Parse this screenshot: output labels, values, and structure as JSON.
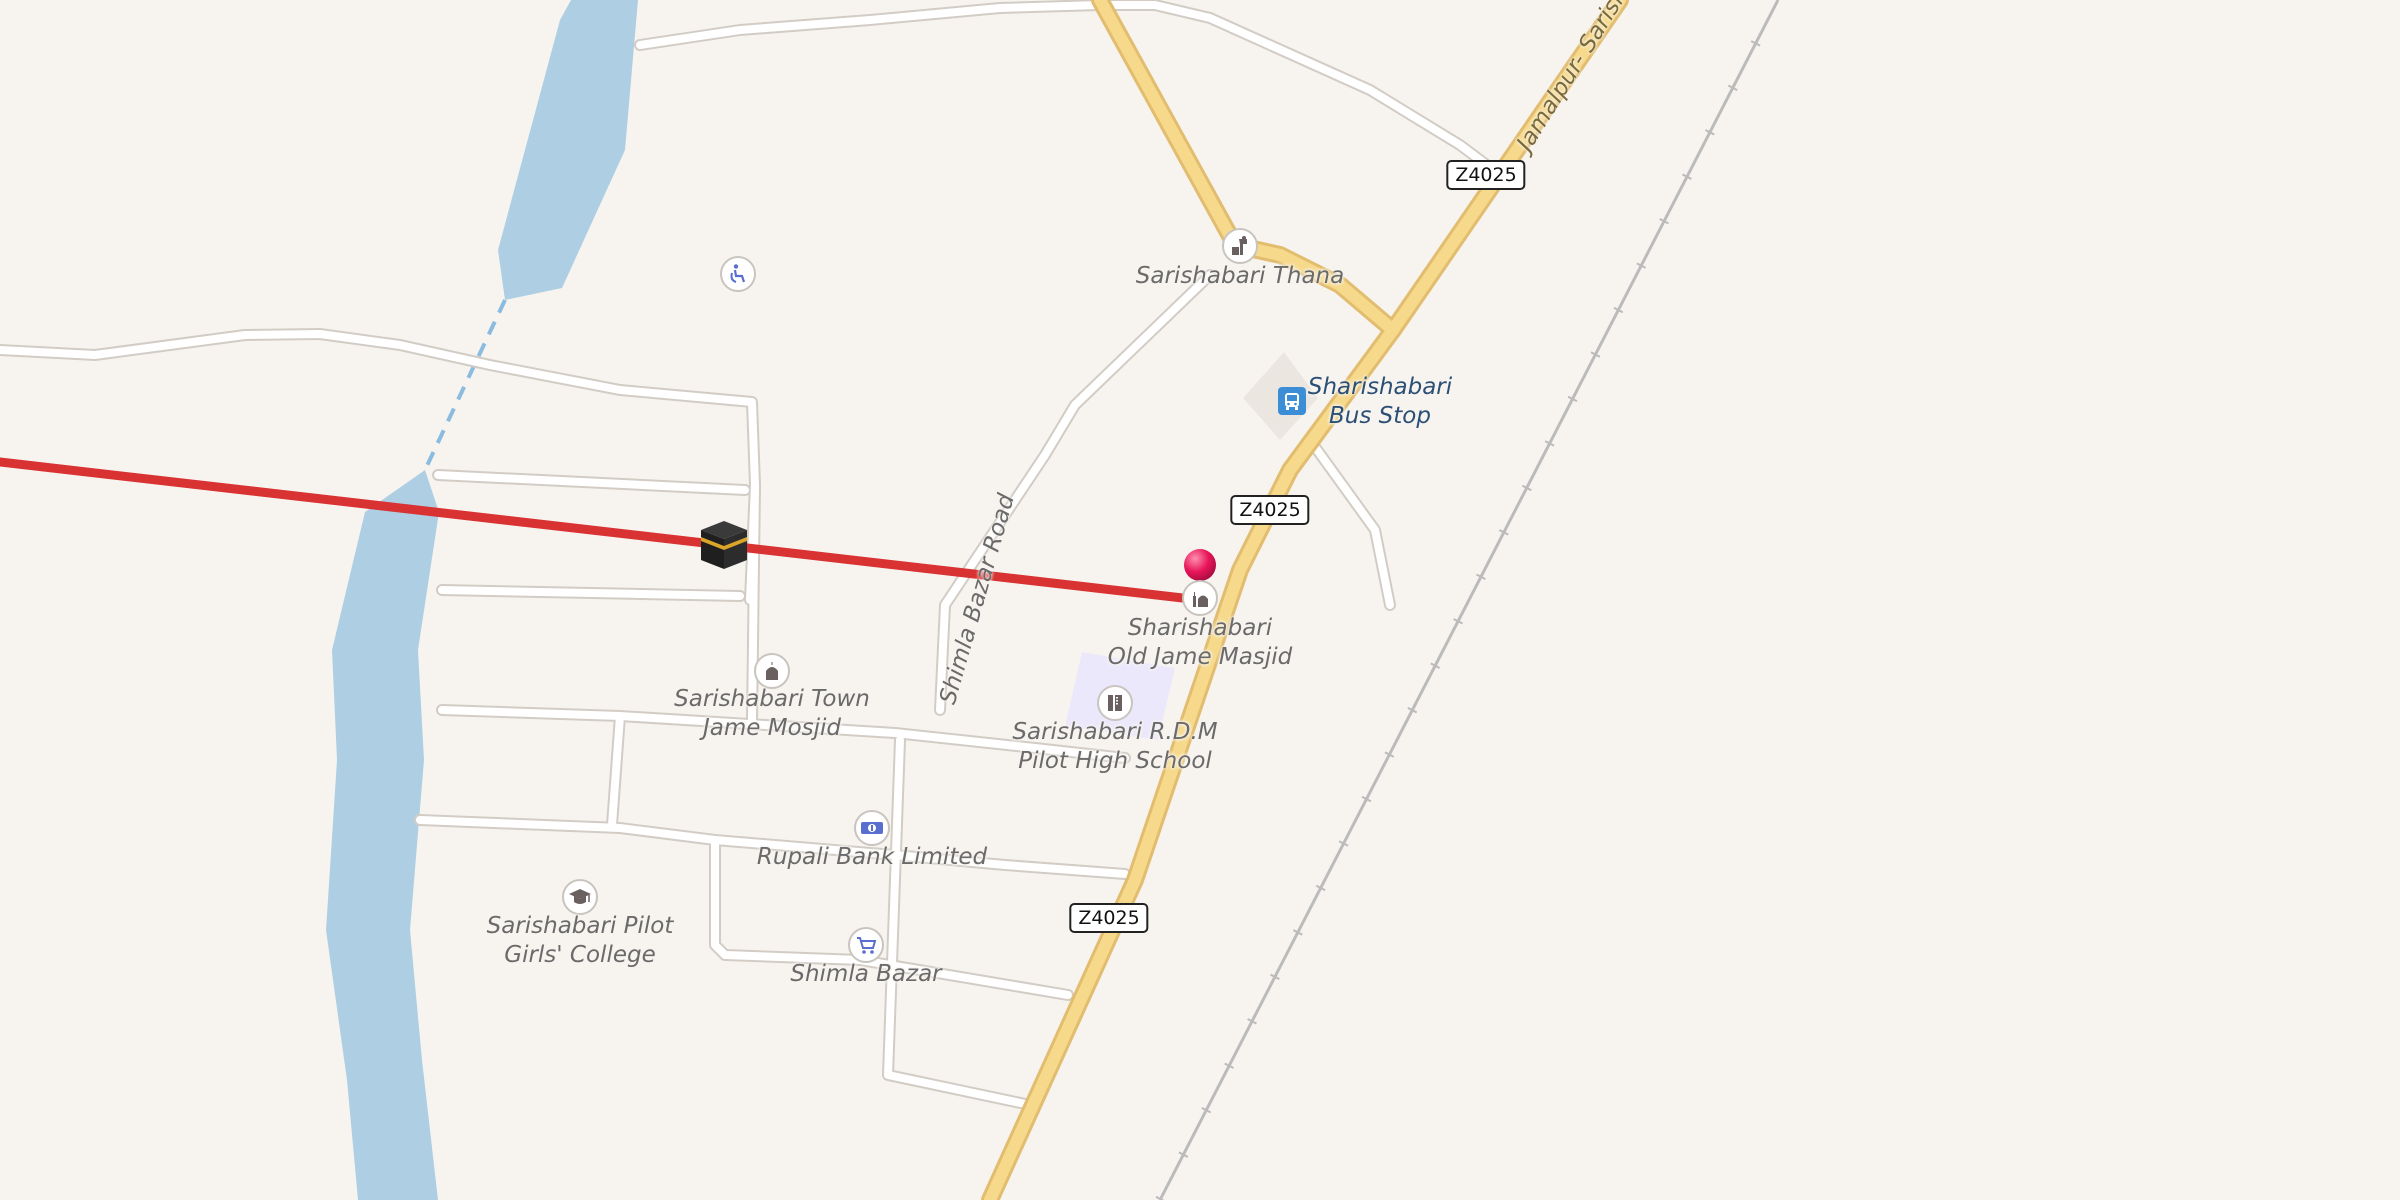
{
  "map": {
    "colors": {
      "land": "#f7f4f0",
      "water": "#aecfe3",
      "primary_road": "#f6d98b",
      "primary_casing": "#e2bd6f",
      "minor_road": "#ffffff",
      "minor_casing": "#d5d0ca",
      "route_line": "#d93232",
      "pin": "#e8155a",
      "school_area": "#ece8fb"
    },
    "roads": {
      "jamalpur": "Jamalpur- Sarisha",
      "shimla_bazar": "Shimla Bazar Road"
    },
    "shields": [
      {
        "id": "shield-1",
        "ref": "Z4025"
      },
      {
        "id": "shield-2",
        "ref": "Z4025"
      },
      {
        "id": "shield-3",
        "ref": "Z4025"
      }
    ],
    "pois": {
      "thana": {
        "name": "Sarishabari Thana",
        "icon": "police-icon"
      },
      "bus_stop": {
        "line1": "Sharishabari",
        "line2": "Bus Stop",
        "icon": "bus-stop-icon"
      },
      "old_masjid": {
        "line1": "Sharishabari",
        "line2": "Old Jame Masjid",
        "icon": "mosque-icon"
      },
      "town_masjid": {
        "line1": "Sarishabari Town",
        "line2": "Jame Mosjid",
        "icon": "mosque-icon"
      },
      "rdm_school": {
        "line1": "Sarishabari R.D.M",
        "line2": "Pilot High School",
        "icon": "school-icon"
      },
      "bank": {
        "name": "Rupali Bank Limited",
        "icon": "bank-icon"
      },
      "girls_college": {
        "line1": "Sarishabari Pilot",
        "line2": "Girls' College",
        "icon": "graduation-cap-icon"
      },
      "shimla_bazar": {
        "name": "Shimla Bazar",
        "icon": "shopping-cart-icon"
      },
      "accessibility": {
        "icon": "wheelchair-icon"
      },
      "kaaba": {
        "icon": "kaaba-icon"
      },
      "destination": {
        "icon": "map-pin-icon"
      }
    }
  }
}
